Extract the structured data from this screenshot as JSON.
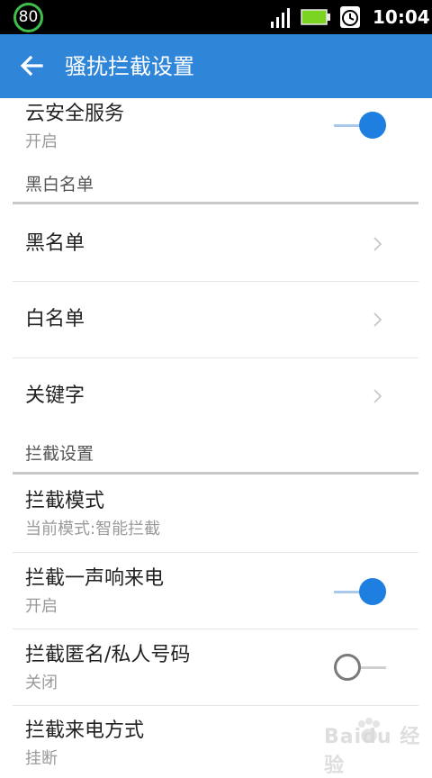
{
  "status_bar": {
    "badge": "80",
    "time": "10:04"
  },
  "app_bar": {
    "title": "骚扰拦截设置"
  },
  "cloud": {
    "title": "云安全服务",
    "status": "开启",
    "enabled": true
  },
  "sections": {
    "list": "黑白名单",
    "intercept": "拦截设置"
  },
  "list_items": [
    "黑名单",
    "白名单",
    "关键字"
  ],
  "intercept_items": [
    {
      "title": "拦截模式",
      "subtitle": "当前模式:智能拦截"
    },
    {
      "title": "拦截一声响来电",
      "subtitle": "开启",
      "enabled": true
    },
    {
      "title": "拦截匿名/私人号码",
      "subtitle": "关闭",
      "enabled": false
    },
    {
      "title": "拦截来电方式",
      "subtitle": "挂断"
    }
  ],
  "watermark": "Baidu 经验",
  "colors": {
    "accent": "#2f86d9",
    "toggle_on": "#1e7fe0"
  }
}
